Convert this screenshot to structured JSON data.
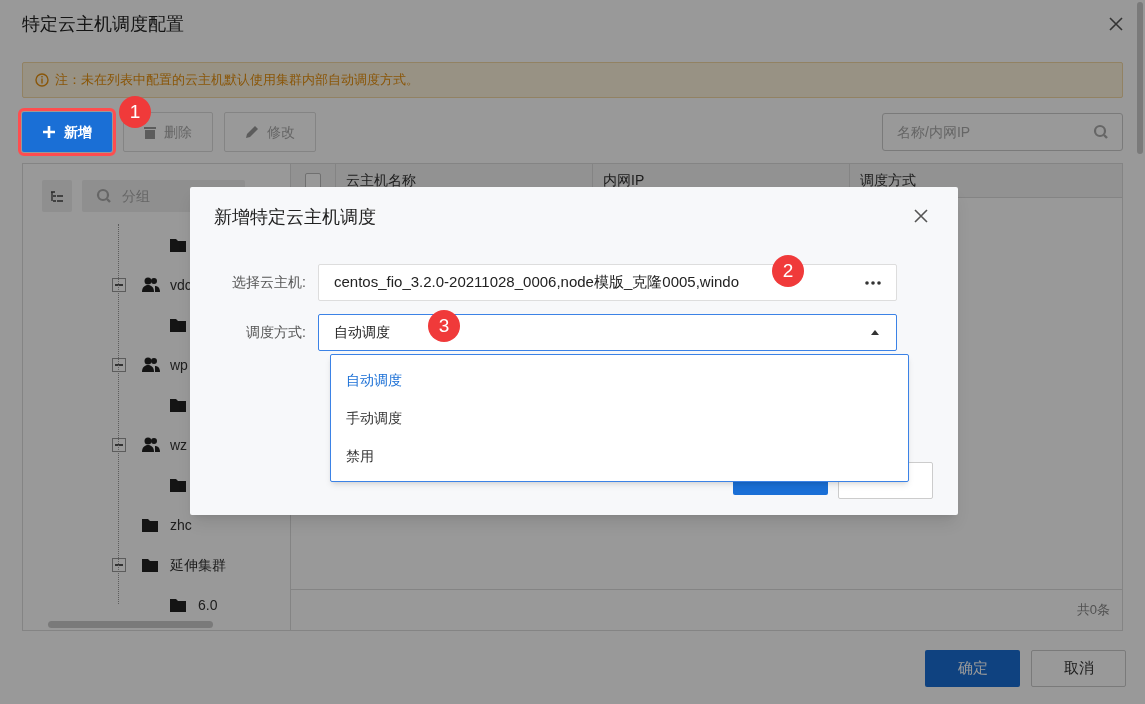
{
  "window": {
    "title": "特定云主机调度配置"
  },
  "notice": "注：未在列表中配置的云主机默认使用集群内部自动调度方式。",
  "toolbar": {
    "buttons": [
      {
        "kind": "add",
        "label": "新增",
        "disabled": false,
        "highlighted": true
      },
      {
        "kind": "delete",
        "label": "删除",
        "disabled": true,
        "highlighted": false
      },
      {
        "kind": "edit",
        "label": "修改",
        "disabled": true,
        "highlighted": false
      }
    ],
    "search": {
      "placeholder": "名称/内网IP"
    }
  },
  "tree": {
    "search": {
      "placeholder": "分组"
    },
    "items": [
      {
        "children": [
          {
            "kind": "folder"
          }
        ]
      },
      {
        "kind": "group",
        "label": "vdc",
        "expanded": true,
        "children": [
          {
            "kind": "folder"
          }
        ]
      },
      {
        "kind": "group",
        "label": "wp",
        "expanded": true,
        "children": [
          {
            "kind": "folder"
          }
        ]
      },
      {
        "kind": "group",
        "label": "wz",
        "expanded": true,
        "children": [
          {
            "kind": "folder"
          }
        ]
      },
      {
        "kind": "folder",
        "label": "zhc"
      },
      {
        "kind": "folder",
        "label": "延伸集群",
        "expanded": true,
        "children": [
          {
            "kind": "folder",
            "label": "6.0"
          }
        ]
      }
    ]
  },
  "table": {
    "select_all": {
      "checked": false
    },
    "columns": [
      "云主机名称",
      "内网IP",
      "调度方式"
    ],
    "total": "共0条"
  },
  "buttons": [
    {
      "kind": "primary",
      "label": "确定"
    },
    {
      "kind": "secondary",
      "label": "取消"
    }
  ],
  "dialog": {
    "title": "新增特定云主机调度",
    "fields": [
      {
        "kind": "picker",
        "label": "选择云主机:",
        "value": "centos_fio_3.2.0-20211028_0006,node模版_克隆0005,windo"
      },
      {
        "kind": "select",
        "label": "调度方式:",
        "value": "自动调度",
        "expanded": true,
        "options": [
          {
            "label": "自动调度",
            "selected": true
          },
          {
            "label": "手动调度",
            "selected": false
          },
          {
            "label": "禁用",
            "selected": false
          }
        ]
      }
    ],
    "buttons": [
      {
        "kind": "primary"
      },
      {
        "kind": "secondary"
      }
    ]
  },
  "annotations": [
    "1",
    "2",
    "3"
  ]
}
